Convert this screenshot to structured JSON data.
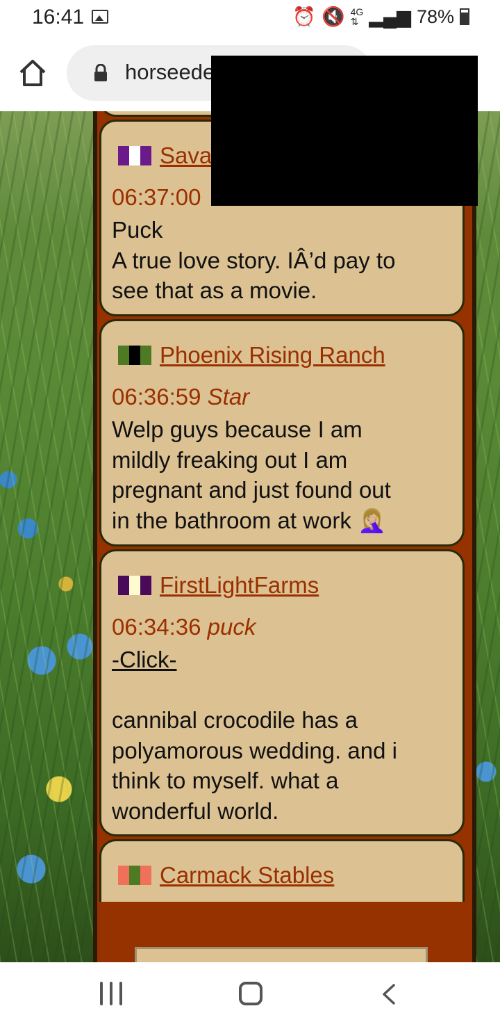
{
  "status_bar": {
    "time": "16:41",
    "battery": "78%",
    "icons": [
      "gallery-icon",
      "alarm-icon",
      "mute-icon",
      "data-4g-icon",
      "signal-icon",
      "battery-icon"
    ]
  },
  "browser": {
    "url": "horseede",
    "icons": [
      "home-icon",
      "lock-icon"
    ]
  },
  "posts": [
    {
      "name": "Sava",
      "time": "06:37:00",
      "author": "",
      "lines": [
        "Puck",
        "A true love story. IÂ’d pay to",
        "see that as a movie."
      ],
      "flag_colors": [
        "#6b1a8a",
        "#ffffff",
        "#6b1a8a"
      ]
    },
    {
      "name": "Phoenix Rising Ranch",
      "time": "06:36:59",
      "author": "Star",
      "lines": [
        "Welp guys because I am",
        "mildly freaking out I am",
        "pregnant and just found out",
        "in the bathroom at work 🤦🏼‍♀️"
      ],
      "flag_colors": [
        "#4f7a24",
        "#000000",
        "#4f7a24"
      ]
    },
    {
      "name": "FirstLightFarms",
      "time": "06:34:36",
      "author": "puck",
      "click_text": "-Click-",
      "lines": [
        "cannibal crocodile has a",
        "polyamorous wedding. and i",
        "think to myself. what a",
        "wonderful world."
      ],
      "flag_colors": [
        "#4a0a5a",
        "#fffad0",
        "#4a0a5a"
      ]
    },
    {
      "name": "Carmack Stables",
      "flag_colors": [
        "#f0705a",
        "#4f7a24",
        "#f0705a"
      ]
    }
  ],
  "nav": {
    "icons": [
      "recent-apps-icon",
      "home-nav-icon",
      "back-icon"
    ]
  }
}
